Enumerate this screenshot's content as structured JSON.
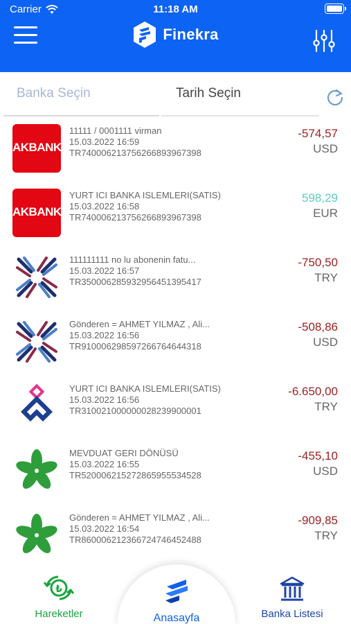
{
  "status_bar": {
    "carrier": "Carrier",
    "time": "11:18 AM"
  },
  "header": {
    "app_name": "Finekra",
    "brand_color": "#0d63f3"
  },
  "segments": {
    "bank": "Banka Seçin",
    "date": "Tarih Seçin"
  },
  "transactions": [
    {
      "bank_logo": "akbank",
      "bank_label": "AKBANK",
      "desc": "11111 / 0001111 virman",
      "date": "15.03.2022 16:59",
      "iban": "TR740006213756266893967398",
      "amount": "-574,57",
      "currency": "USD",
      "sign": "neg"
    },
    {
      "bank_logo": "akbank",
      "bank_label": "AKBANK",
      "desc": "YURT ICI BANKA ISLEMLERI(SATIS)",
      "date": "15.03.2022 16:58",
      "iban": "TR740006213756266893967398",
      "amount": "598,29",
      "currency": "EUR",
      "sign": "pos"
    },
    {
      "bank_logo": "star-bank",
      "desc": "111111111 no lu abonenin fatu...",
      "date": "15.03.2022 16:57",
      "iban": "TR350006285932956451395417",
      "amount": "-750,50",
      "currency": "TRY",
      "sign": "neg"
    },
    {
      "bank_logo": "star-bank",
      "desc": "Gönderen = AHMET YILMAZ , Ali...",
      "date": "15.03.2022 16:56",
      "iban": "TR910006298597266764644318",
      "amount": "-508,86",
      "currency": "USD",
      "sign": "neg"
    },
    {
      "bank_logo": "diamond-bank",
      "desc": "YURT ICI BANKA ISLEMLERI(SATIS)",
      "date": "15.03.2022 16:56",
      "iban": "TR310021000000028239900001",
      "amount": "-6.650,00",
      "currency": "TRY",
      "sign": "neg"
    },
    {
      "bank_logo": "clover-bank",
      "desc": "MEVDUAT GERI DÖNÜSÜ",
      "date": "15.03.2022 16:55",
      "iban": "TR520006215272865955534528",
      "amount": "-455,10",
      "currency": "USD",
      "sign": "neg"
    },
    {
      "bank_logo": "clover-bank",
      "desc": "Gönderen = AHMET YILMAZ , Ali...",
      "date": "15.03.2022 16:54",
      "iban": "TR860006212366724746452488",
      "amount": "-909,85",
      "currency": "TRY",
      "sign": "neg"
    }
  ],
  "tabbar": {
    "left": {
      "label": "Hareketler",
      "icon": "lira-refresh-icon"
    },
    "center": {
      "label": "Anasayfa",
      "icon": "finekra-logo-icon"
    },
    "right": {
      "label": "Banka Listesi",
      "icon": "bank-building-icon"
    }
  },
  "colors": {
    "negative": "#9c1f1f",
    "positive": "#5ecbc2",
    "tab_left": "#19a43f",
    "tab_center": "#1160e8",
    "tab_right": "#1f44a6"
  }
}
